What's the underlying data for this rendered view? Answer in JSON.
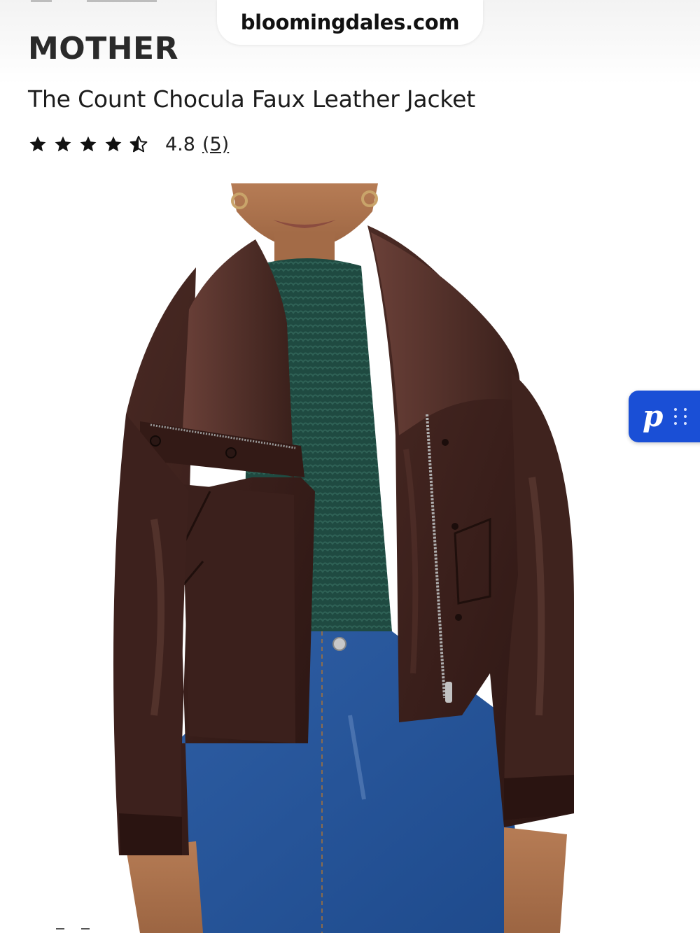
{
  "browser": {
    "url": "bloomingdales.com"
  },
  "product": {
    "brand": "MOTHER",
    "title": "The Count Chocula Faux Leather Jacket",
    "rating": {
      "value": "4.8",
      "count": "(5)",
      "stars_filled": 4.5,
      "stars_total": 5
    },
    "image_icon": "product-photo-icon"
  },
  "floating_widget": {
    "icon": "p-logo-icon",
    "glyph": "p",
    "color": "#1a4fd6"
  },
  "colors": {
    "text": "#1b1b1b",
    "widget_blue": "#1a4fd6",
    "star": "#111111"
  }
}
